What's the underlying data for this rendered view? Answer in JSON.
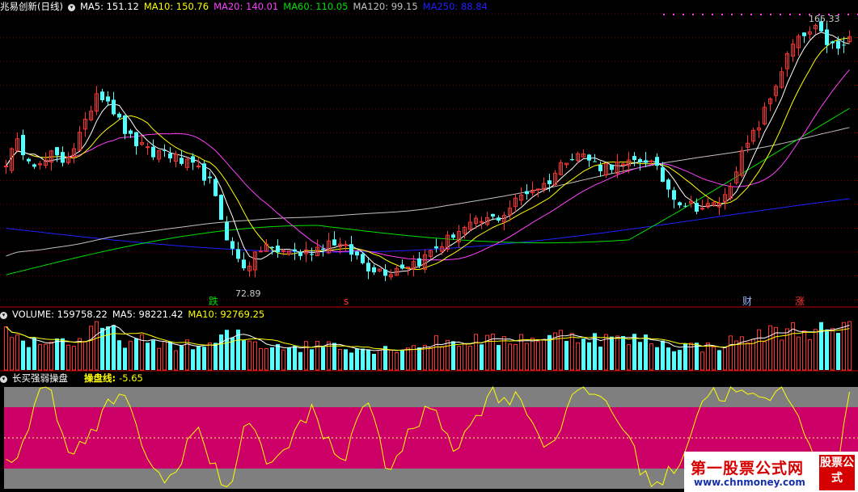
{
  "header": {
    "stock": "兆易创新(日线)",
    "ma5": "MA5: 151.12",
    "ma10": "MA10: 150.76",
    "ma20": "MA20: 140.01",
    "ma60": "MA60: 110.05",
    "ma120": "MA120: 99.15",
    "ma250": "MA250: 88.84"
  },
  "volume_header": {
    "volume": "VOLUME: 159758.22",
    "ma5": "MA5: 98221.42",
    "ma10": "MA10: 92769.25"
  },
  "indicator_header": {
    "name": "长买强弱操盘",
    "line_label": "操盘线:",
    "line_value": "-5.65"
  },
  "markers": {
    "high_label": "165.33",
    "low_label": "72.89",
    "die": "跌",
    "s": "s",
    "cai": "财",
    "zhang": "涨"
  },
  "watermark": {
    "name": "第一股票公式网",
    "url": "www.chnmoney.com",
    "box": "股票公式"
  },
  "colors": {
    "up": "#ff3232",
    "down": "#54ffff",
    "ma5": "#ffffff",
    "ma10": "#ffff00",
    "ma20": "#ff40ff",
    "ma60": "#00e000",
    "ma120": "#c0c0c0",
    "ma250": "#2020ff",
    "band_gray": "#7f7f7f",
    "band_pink": "#cc0066",
    "osc": "#ffff00"
  },
  "chart_data": {
    "type": "candlestick",
    "y_range": [
      72.89,
      165.33
    ],
    "close_path": [
      116,
      122,
      118,
      114,
      118,
      116,
      121,
      128,
      140,
      138,
      130,
      124,
      121,
      118,
      120,
      117,
      115,
      113,
      110,
      98,
      86,
      80,
      82,
      88,
      84,
      86,
      84,
      85,
      87,
      89,
      86,
      84,
      80,
      79,
      78,
      80,
      81,
      82,
      86,
      88,
      92,
      93,
      95,
      96,
      97,
      101,
      105,
      107,
      108,
      113,
      118,
      119,
      116,
      114,
      115,
      114,
      116,
      117,
      112,
      106,
      102,
      101,
      100,
      101,
      104,
      115,
      122,
      129,
      138,
      148,
      156,
      159,
      161,
      157,
      154,
      158
    ],
    "volume_path": [
      48,
      40,
      36,
      34,
      38,
      36,
      34,
      38,
      50,
      52,
      40,
      34,
      36,
      30,
      34,
      32,
      30,
      30,
      28,
      38,
      44,
      40,
      34,
      30,
      32,
      30,
      28,
      30,
      32,
      34,
      30,
      28,
      26,
      26,
      26,
      28,
      30,
      30,
      34,
      36,
      34,
      36,
      38,
      36,
      36,
      38,
      40,
      40,
      38,
      42,
      44,
      44,
      40,
      38,
      40,
      36,
      38,
      38,
      34,
      30,
      30,
      30,
      28,
      30,
      34,
      36,
      40,
      42,
      46,
      48,
      50,
      48,
      52,
      46,
      44,
      58
    ],
    "oscillator_path": [
      30,
      35,
      60,
      95,
      100,
      55,
      35,
      45,
      60,
      80,
      95,
      75,
      50,
      20,
      5,
      15,
      45,
      60,
      30,
      10,
      5,
      50,
      70,
      30,
      25,
      40,
      60,
      80,
      55,
      40,
      20,
      70,
      90,
      50,
      20,
      35,
      55,
      70,
      85,
      60,
      40,
      55,
      75,
      95,
      92,
      88,
      90,
      60,
      40,
      55,
      85,
      92,
      96,
      90,
      75,
      60,
      30,
      10,
      5,
      15,
      30,
      60,
      90,
      95,
      92,
      96,
      90,
      85,
      92,
      95,
      88,
      60,
      20,
      10,
      30,
      96
    ]
  }
}
